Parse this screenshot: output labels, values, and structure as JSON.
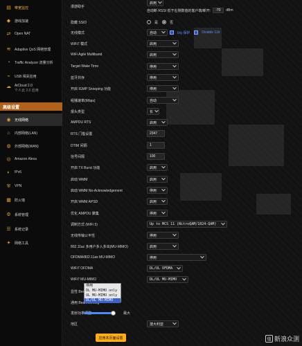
{
  "sidebar": {
    "items": [
      {
        "label": "带宽监控",
        "ico": "▤",
        "name": "sidebar-item-bandwidth"
      },
      {
        "label": "游戏加速",
        "ico": "◆",
        "name": "sidebar-item-game-boost"
      },
      {
        "label": "Open NAT",
        "ico": "⇄",
        "name": "sidebar-item-open-nat"
      },
      {
        "label": "Adaptive QoS 网络管理",
        "ico": "≋",
        "name": "sidebar-item-adaptive-qos"
      },
      {
        "label": "Traffic Analyzer 流量分析",
        "ico": "◔",
        "name": "sidebar-item-traffic-analyzer"
      },
      {
        "label": "USB 相关应用",
        "ico": "⌁",
        "name": "sidebar-item-usb"
      },
      {
        "label": "AiCloud 2.0",
        "sub": "个人云 2.0 应用",
        "ico": "☁",
        "name": "sidebar-item-aicloud"
      }
    ],
    "section_title": "高级设置",
    "advanced": [
      {
        "label": "无线网络",
        "ico": "◉",
        "name": "sidebar-item-wireless"
      },
      {
        "label": "内部网络(LAN)",
        "ico": "⌂",
        "name": "sidebar-item-lan"
      },
      {
        "label": "外部网络(WAN)",
        "ico": "◍",
        "name": "sidebar-item-wan"
      },
      {
        "label": "Amazon Alexa",
        "ico": "◎",
        "name": "sidebar-item-alexa"
      },
      {
        "label": "IPv6",
        "ico": "◐",
        "name": "sidebar-item-ipv6"
      },
      {
        "label": "VPN",
        "ico": "⛨",
        "name": "sidebar-item-vpn"
      },
      {
        "label": "防火墙",
        "ico": "▦",
        "name": "sidebar-item-firewall"
      },
      {
        "label": "系统管理",
        "ico": "⚙",
        "name": "sidebar-item-admin"
      },
      {
        "label": "系统记录",
        "ico": "☰",
        "name": "sidebar-item-syslog"
      },
      {
        "label": "网络工具",
        "ico": "✦",
        "name": "sidebar-item-network-tools"
      }
    ]
  },
  "settings": {
    "roaming_label": "漫游助手",
    "roaming_value": "启用",
    "roaming_desc": "自动断 RSSI 低于右侧数值的客户端/断开:",
    "roaming_rssi": "-70",
    "roaming_unit": "dBm",
    "hide_ssid_label": "隐藏 SSID",
    "hide_ssid_yes": "是",
    "hide_ssid_no": "否",
    "wireless_mode_label": "无线模式",
    "wireless_mode_value": "自动",
    "bg_protect": "b/g 保护",
    "disable_11b": "Disable 11b",
    "wifi7_mode_label": "WiFi7 模式",
    "wifi7_mode_value": "启用",
    "wifi_agile_label": "WiFi Agile Multiband",
    "wifi_agile_value": "启用",
    "twt_label": "Target Wake Time",
    "twt_value": "停用",
    "bt_coex_label": "蓝牙共存",
    "bt_coex_value": "停用",
    "igmp_label": "开启 IGMP Snooping 功能",
    "igmp_value": "停用",
    "mcast_label": "组播速率(Mbps)",
    "mcast_value": "自动",
    "preamble_label": "报头类型",
    "preamble_value": "长",
    "ampdu_rts_label": "AMPDU RTS",
    "ampdu_rts_value": "启用",
    "rts_label": "RTS 门槛设置",
    "rts_value": "2347",
    "dtim_label": "DTIM 间隔",
    "dtim_value": "1",
    "beacon_label": "信号间隔",
    "beacon_value": "100",
    "txburst_label": "开启 TX Burst 功能",
    "txburst_value": "启用",
    "wmm_label": "启动 WMM",
    "wmm_value": "启用",
    "wmm_noack_label": "启动 WMM No-Acknowledgement",
    "wmm_noack_value": "停用",
    "wmm_apsd_label": "开启 WMM APSD",
    "wmm_apsd_value": "启用",
    "ampdu_opt_label": "优化 AMPDU 聚集",
    "ampdu_opt_value": "停用",
    "modulation_label": "调制方式 (WiFi 5)",
    "modulation_value": "Up to MCS 11 (NitroQAM/1024-QAM)",
    "airtime_label": "无线传输公平性",
    "airtime_value": "停用",
    "mumimo_ac_label": "802.11ac 多用户多入多出(MU-MIMO)",
    "mumimo_ac_value": "启用",
    "ofdma_ax_label": "OFDMA/802.11ax MU-MIMO",
    "ofdma_ax_value": "停用",
    "wifi7_ofdma_label": "WiFi7 OFDMA",
    "wifi7_ofdma_value": "DL/UL OFDMA",
    "wifi7_mumimo_label": "WiFi7 MU-MIMO",
    "wifi7_mumimo_value": "DL/UL MU-MIMO",
    "explicit_bf_label": "显性 Beamforming",
    "universal_bf_label": "通用 Beamforming",
    "mumimo_options": [
      "停用",
      "DL MU-MIMO only",
      "UL MU-MIMO only",
      "DL/UL MU-MIMO"
    ],
    "txpower_label": "发射功率调整",
    "txpower_value": "最大",
    "txpower_level": 1.0,
    "region_label": "地区",
    "region_value": "澳大利亚",
    "apply_label": "应用本页面设置"
  },
  "watermark": {
    "logo": "值",
    "text": "新浪众测"
  }
}
